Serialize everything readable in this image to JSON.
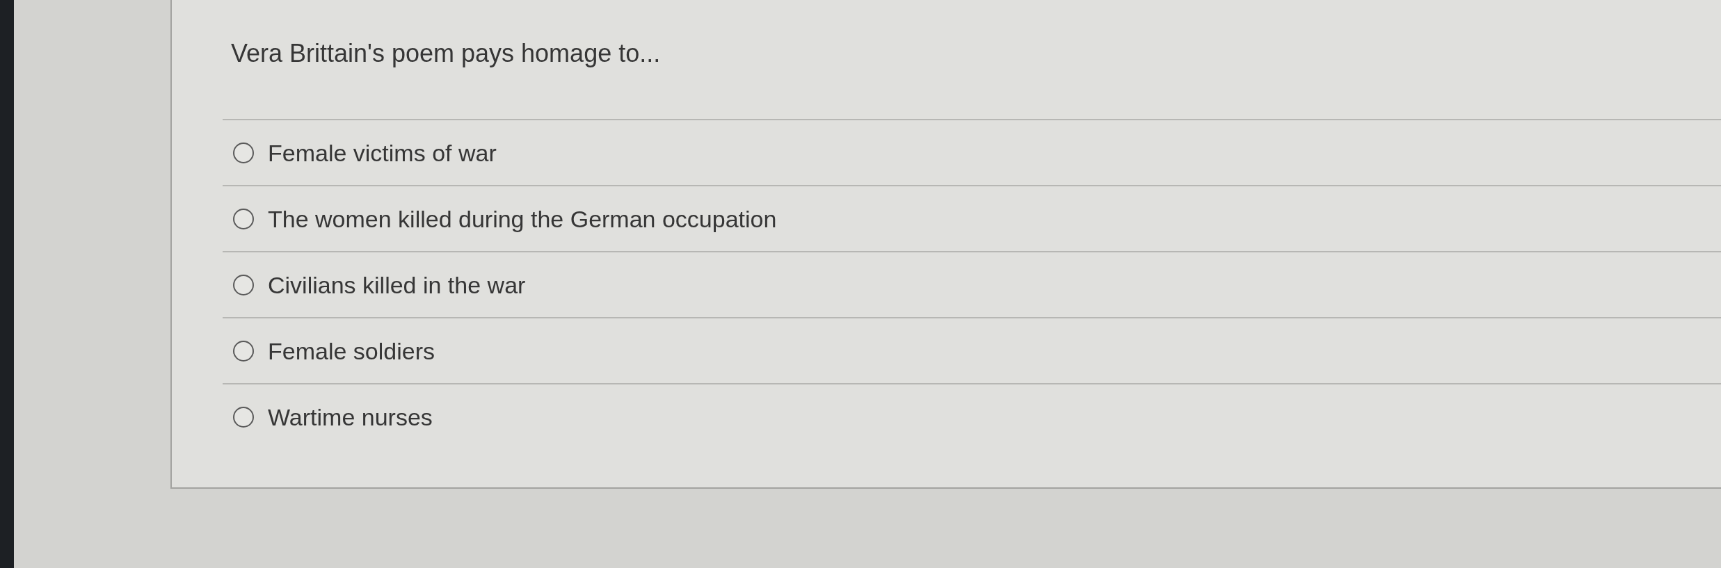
{
  "question": {
    "text": "Vera Brittain's poem pays homage to..."
  },
  "options": [
    {
      "label": "Female victims of war",
      "selected": false
    },
    {
      "label": "The women killed during the German occupation",
      "selected": false
    },
    {
      "label": "Civilians killed in the war",
      "selected": false
    },
    {
      "label": "Female soldiers",
      "selected": false
    },
    {
      "label": "Wartime nurses",
      "selected": false
    }
  ]
}
